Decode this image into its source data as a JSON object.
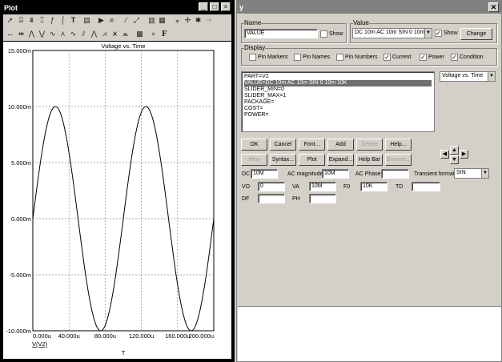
{
  "plot_window": {
    "title": "Plot",
    "controls": [
      "_",
      "□",
      "×"
    ]
  },
  "chart_data": {
    "type": "line",
    "title": "Voltage vs. Time",
    "xlabel": "T",
    "legend": "V(V2)",
    "x_ticks": [
      "0.000u",
      "40.000u",
      "80.000u",
      "120.000u",
      "160.000u",
      "200.000u"
    ],
    "y_ticks": [
      "15.000m",
      "10.000m",
      "5.000m",
      "0.000m",
      "-5.000m",
      "-10.000m"
    ],
    "xlim": [
      0,
      200
    ],
    "ylim": [
      -10,
      15
    ],
    "series": [
      {
        "frequency_khz": 10,
        "amplitude_mv": 10,
        "offset_mv": 0
      }
    ],
    "grid": true,
    "line_color": "#000000"
  },
  "y_window": {
    "title": "y",
    "name_group": "Name",
    "name_value": "VALUE",
    "name_show_label": "Show",
    "value_group": "Value",
    "value_select": "DC 10m AC 10m SIN 0 10m",
    "value_show_label": "Show",
    "value_show_checked": "✓",
    "change_btn": "Change",
    "display_group": "Display",
    "display": [
      {
        "label": "Pin Markers",
        "checked": ""
      },
      {
        "label": "Pin Names",
        "checked": ""
      },
      {
        "label": "Pin Numbers",
        "checked": ""
      },
      {
        "label": "Current",
        "checked": "✓"
      },
      {
        "label": "Power",
        "checked": "✓"
      },
      {
        "label": "Condition",
        "checked": "✓"
      }
    ],
    "text_lines": [
      "PART=V2",
      "VALUE=DC 10m AC 10m SIN 0 10m 10K",
      "SLIDER_MIN=0",
      "SLIDER_MAX=1",
      "PACKAGE=",
      "COST=",
      "POWER="
    ],
    "plot_select": "Voltage vs. Time",
    "buttons_row1": [
      "OK",
      "Cancel",
      "Font...",
      "Add",
      "Delete",
      "Help..."
    ],
    "buttons_row2": [
      "New",
      "Syntax...",
      "Plot",
      "Expand...",
      "Help Bar",
      "Browse..."
    ],
    "dc_label": "DC",
    "dc_value": "10M",
    "acmag_label": "AC magnitude",
    "acmag_value": "10M",
    "acphase_label": "AC Phase",
    "acphase_value": "",
    "tf_label": "Transient format",
    "tf_value": "SIN",
    "vo_label": "VO",
    "vo_value": "0",
    "va_label": "VA",
    "va_value": "10M",
    "fo_label": "F0",
    "fo_value": "10K",
    "td_label": "TD",
    "td_value": "",
    "df_label": "DF",
    "df_value": "",
    "ph_label": "PH",
    "ph_value": ""
  }
}
